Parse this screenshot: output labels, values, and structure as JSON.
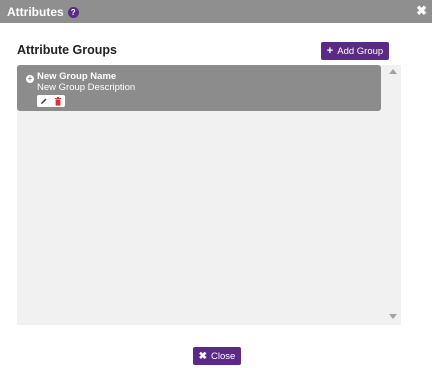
{
  "dialog": {
    "title": "Attributes",
    "help_glyph": "?",
    "close_glyph": "✖"
  },
  "attribute_groups": {
    "heading": "Attribute Groups",
    "add_button_icon": "+",
    "add_button_label": "Add Group",
    "groups": [
      {
        "name": "New Group Name",
        "description": "New Group Description",
        "expand_icon": "plus-circle-icon",
        "actions": [
          "pencil-icon",
          "trash-icon"
        ]
      }
    ]
  },
  "footer": {
    "close_icon": "✖",
    "close_label": "Close"
  },
  "colors": {
    "accent": "#5b2a86",
    "titlebar": "#8f8f8f",
    "card": "#8c8c8c",
    "list_bg": "#f1f1f1",
    "delete_icon": "#d9342b"
  }
}
